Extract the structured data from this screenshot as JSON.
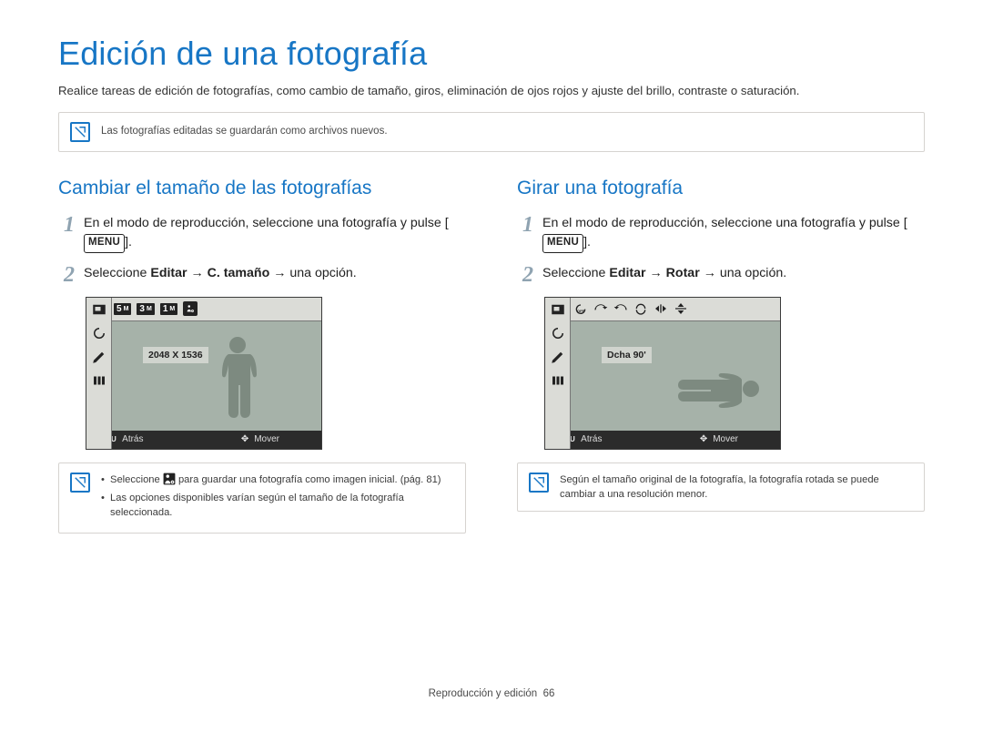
{
  "page": {
    "title": "Edición de una fotografía",
    "lead": "Realice tareas de edición de fotografías, como cambio de tamaño, giros, eliminación de ojos rojos y ajuste del brillo, contraste o saturación.",
    "note_top": "Las fotografías editadas se guardarán como archivos nuevos.",
    "footer_section": "Reproducción y edición",
    "footer_page": "66"
  },
  "labels": {
    "menu_button": "MENU",
    "arrow": "→"
  },
  "lcd": {
    "back_label": "Atrás",
    "move_label": "Mover",
    "menu_tiny": "MENU"
  },
  "left": {
    "title": "Cambiar el tamaño de las fotografías",
    "step1_a": "En el modo de reproducción, seleccione una fotografía y pulse [",
    "step1_b": "].",
    "step2_a": "Seleccione ",
    "step2_b": "Editar",
    "step2_c": "C. tamaño",
    "step2_d": " una opción.",
    "lcd": {
      "chips": [
        "5",
        "3",
        "1"
      ],
      "chip_unit": "M",
      "caption": "2048 X 1536"
    },
    "foot_bullet1_a": "Seleccione ",
    "foot_bullet1_b": " para guardar una fotografía como imagen inicial. (pág. 81)",
    "foot_bullet2": "Las opciones disponibles varían según el tamaño de la fotografía seleccionada."
  },
  "right": {
    "title": "Girar una fotografía",
    "step1_a": "En el modo de reproducción, seleccione una fotografía y pulse [",
    "step1_b": "].",
    "step2_a": "Seleccione ",
    "step2_b": "Editar",
    "step2_c": "Rotar",
    "step2_d": " una opción.",
    "lcd": {
      "caption": "Dcha 90'"
    },
    "footnote": "Según el tamaño original de la fotografía, la fotografía rotada se puede cambiar a una resolución menor."
  }
}
